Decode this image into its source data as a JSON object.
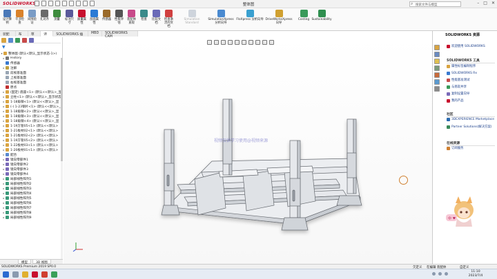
{
  "titlebar": {
    "brand": "SOLIDWORKS",
    "document_title": "整体图",
    "search_placeholder": "搜索文件与模型"
  },
  "ribbon": {
    "buttons": [
      {
        "label": "设计算例",
        "color": "#4a78b8",
        "disabled": false
      },
      {
        "label": "干涉检查",
        "color": "#d9822b",
        "disabled": false
      },
      {
        "label": "间隙验证",
        "color": "#7a9cc6",
        "disabled": false
      },
      {
        "label": "孔对齐",
        "color": "#6a6a6a",
        "disabled": false
      },
      {
        "label": "测量",
        "color": "#3d8b3d",
        "disabled": false
      },
      {
        "label": "标注尺寸",
        "color": "#5a5a9a",
        "disabled": false
      },
      {
        "label": "质量属性",
        "color": "#c8102e",
        "disabled": false
      },
      {
        "label": "剖面属性",
        "color": "#2a7ad5",
        "disabled": false
      },
      {
        "label": "传感器",
        "color": "#9a6a2a",
        "disabled": false
      },
      {
        "label": "性能评估",
        "color": "#555555",
        "disabled": false
      },
      {
        "label": "装配体直观",
        "color": "#c84a8a",
        "disabled": false
      },
      {
        "label": "检查",
        "color": "#3a8a8a",
        "disabled": false
      },
      {
        "label": "比较文档",
        "color": "#6a6ab8",
        "disabled": false
      },
      {
        "label": "检查激活的文档",
        "color": "#d04040",
        "disabled": false
      },
      {
        "label": "Simulation Standard",
        "color": "#9aa6b8",
        "disabled": true
      },
      {
        "label": "SimulationXpress 分析向导",
        "color": "#4a8ad0",
        "disabled": false
      },
      {
        "label": "FloXpress 分析向导",
        "color": "#3aa0d0",
        "disabled": false
      },
      {
        "label": "DriveWorksXpress 向导",
        "color": "#d0a030",
        "disabled": false
      },
      {
        "label": "Costing",
        "color": "#3a9a5a",
        "disabled": false
      },
      {
        "label": "Sustainability",
        "color": "#2f8f4f",
        "disabled": false
      }
    ]
  },
  "command_tabs": [
    "装配体",
    "布局",
    "草图",
    "评估",
    "SOLIDWORKS 插件",
    "MBD",
    "SOLIDWORKS CAM"
  ],
  "active_command_tab": 3,
  "tree": [
    {
      "label": "整体图  (默认<默认_显示状态-1>)",
      "icon": "#d9a441",
      "expand": "▾",
      "indent": 0
    },
    {
      "label": "History",
      "icon": "#777777",
      "expand": "▸",
      "indent": 1
    },
    {
      "label": "传感器",
      "icon": "#3a7ad0",
      "expand": "",
      "indent": 1
    },
    {
      "label": "注解",
      "icon": "#c0a040",
      "expand": "▸",
      "indent": 1
    },
    {
      "label": "前视基准面",
      "icon": "#9aa7b5",
      "expand": "",
      "indent": 1
    },
    {
      "label": "上视基准面",
      "icon": "#9aa7b5",
      "expand": "",
      "indent": 1
    },
    {
      "label": "右视基准面",
      "icon": "#9aa7b5",
      "expand": "",
      "indent": 1
    },
    {
      "label": "原点",
      "icon": "#c03030",
      "expand": "",
      "indent": 1
    },
    {
      "label": "(固定) 底座<1> (默认<<默认>_显示",
      "icon": "#d9a441",
      "expand": "▸",
      "indent": 1
    },
    {
      "label": "立柱<1> (默认<<默认>_显示状态",
      "icon": "#d9a441",
      "expand": "▸",
      "indent": 1
    },
    {
      "label": "1-18角钢<1> (默认<<默认>_显",
      "icon": "#d9a441",
      "expand": "▸",
      "indent": 1
    },
    {
      "label": "(-) 1-23钢片<1> (默认<<默认>_显",
      "icon": "#d9a441",
      "expand": "▸",
      "indent": 1
    },
    {
      "label": "1-18角钢<2> (默认<<默认>_显",
      "icon": "#d9a441",
      "expand": "▸",
      "indent": 1
    },
    {
      "label": "1-18角钢<3> (默认<<默认>_显",
      "icon": "#d9a441",
      "expand": "▸",
      "indent": 1
    },
    {
      "label": "1-18角钢<4> (默认<<默认>_显",
      "icon": "#d9a441",
      "expand": "▸",
      "indent": 1
    },
    {
      "label": "1-19方管05<1> (默认<<默认>",
      "icon": "#d9a441",
      "expand": "▸",
      "indent": 1
    },
    {
      "label": "1-21板材02<1> (默认<<默认>",
      "icon": "#d9a441",
      "expand": "▸",
      "indent": 1
    },
    {
      "label": "1-21板材02<2> (默认<<默认>",
      "icon": "#d9a441",
      "expand": "▸",
      "indent": 1
    },
    {
      "label": "1-19方管05<2> (默认<<默认>",
      "icon": "#d9a441",
      "expand": "▸",
      "indent": 1
    },
    {
      "label": "1-22板材03<1> (默认<<默认>",
      "icon": "#d9a441",
      "expand": "▸",
      "indent": 1
    },
    {
      "label": "1-20板材01<1> (默认<<默认>",
      "icon": "#d9a441",
      "expand": "▸",
      "indent": 1
    },
    {
      "label": "配合",
      "icon": "#5a8ad0",
      "expand": "▸",
      "indent": 1
    },
    {
      "label": "镜向零部件1",
      "icon": "#7a6ab8",
      "expand": "▸",
      "indent": 1
    },
    {
      "label": "镜向零部件2",
      "icon": "#7a6ab8",
      "expand": "▸",
      "indent": 1
    },
    {
      "label": "镜向零部件3",
      "icon": "#7a6ab8",
      "expand": "▸",
      "indent": 1
    },
    {
      "label": "镜向零部件4",
      "icon": "#7a6ab8",
      "expand": "▸",
      "indent": 1
    },
    {
      "label": "局部线性阵列1",
      "icon": "#3a9a7a",
      "expand": "▸",
      "indent": 1
    },
    {
      "label": "局部线性阵列2",
      "icon": "#3a9a7a",
      "expand": "▸",
      "indent": 1
    },
    {
      "label": "局部线性阵列3",
      "icon": "#3a9a7a",
      "expand": "▸",
      "indent": 1
    },
    {
      "label": "局部线性阵列4",
      "icon": "#3a9a7a",
      "expand": "▸",
      "indent": 1
    },
    {
      "label": "局部线性阵列5",
      "icon": "#3a9a7a",
      "expand": "▸",
      "indent": 1
    },
    {
      "label": "局部线性阵列6",
      "icon": "#3a9a7a",
      "expand": "▸",
      "indent": 1
    },
    {
      "label": "局部线性阵列7",
      "icon": "#3a9a7a",
      "expand": "▸",
      "indent": 1
    },
    {
      "label": "局部线性阵列8",
      "icon": "#3a9a7a",
      "expand": "▸",
      "indent": 1
    },
    {
      "label": "局部线性阵列9",
      "icon": "#3a9a7a",
      "expand": "▸",
      "indent": 1
    }
  ],
  "bottom_tabs": [
    "模型",
    "3D 视图"
  ],
  "status": {
    "left": "SOLIDWORKS Premium 2019 SP0.0",
    "r1": "欠定义",
    "r2": "在编辑 装配体",
    "r3": "自定义"
  },
  "viewport": {
    "watermark": "视频仅供学习使用@视频来源"
  },
  "taskpane": {
    "header": "SOLIDWORKS 资源",
    "welcome": "欢迎使用 SOLIDWORKS",
    "tools_title": "SOLIDWORKS 工具",
    "tools": [
      "属性标签编制程序",
      "SOLIDWORKS Rx",
      "性能基准测试",
      "与朋友共享",
      "复制设置向导",
      "我的产品"
    ],
    "community_title": "社区",
    "community": [
      "3DEXPERIENCE Marketplace",
      "Partner Solutions(解决方案)"
    ],
    "online_title": "在线资源",
    "online": [
      "订阅服务"
    ]
  },
  "taskbar": {
    "time": "11:10",
    "date": "2023/7/4"
  },
  "colors": {
    "brand_red": "#c8102e",
    "link_blue": "#1a3e8a",
    "model_fill": "#e6e8ec",
    "model_stroke": "#666a70"
  }
}
